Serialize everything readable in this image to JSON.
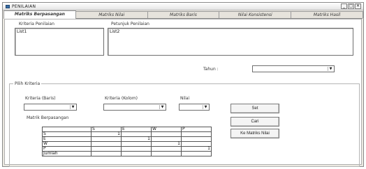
{
  "window": {
    "title": "PENILAIAN",
    "minimize": "_",
    "maximize": "□",
    "close": "✕"
  },
  "tabs": [
    "Matriks Berpasangan",
    "Matriks Nilai",
    "Matriks Baris",
    "Nilai Konsistensi",
    "Matriks Hasil"
  ],
  "kriteria": {
    "label": "Kriteria Penilaian",
    "list_item": "List1"
  },
  "petunjuk": {
    "label": "Petunjuk Penilaian",
    "list_item": "List2"
  },
  "tahun": {
    "label": "Tahun :",
    "value": ""
  },
  "group": {
    "title": "Pilih Kriteria",
    "baris_label": "Kriteria (Baris)",
    "kolom_label": "Kriteria (Kolom)",
    "nilai_label": "Nilai",
    "matrix_label": "Matrik Berpasangan"
  },
  "buttons": {
    "set": "Set",
    "cari": "Cari",
    "ke_matriks": "Ke Matriks Nilai"
  },
  "matrix": {
    "columns": [
      "",
      "S",
      "E",
      "W",
      "P"
    ],
    "rows": [
      [
        "S",
        "1",
        "",
        "",
        ""
      ],
      [
        "E",
        "",
        "1",
        "",
        ""
      ],
      [
        "W",
        "",
        "",
        "1",
        ""
      ],
      [
        "P",
        "",
        "",
        "",
        "1"
      ],
      [
        "Jumlah",
        "",
        "",
        "",
        ""
      ]
    ]
  }
}
